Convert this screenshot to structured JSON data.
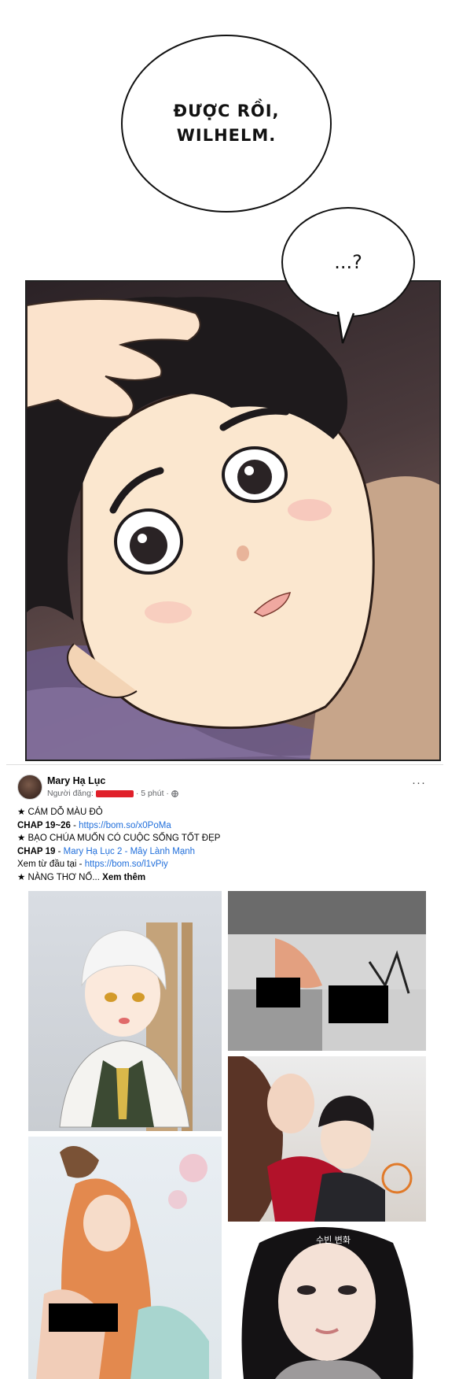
{
  "comic": {
    "bubble1_text": "ĐƯỢC RỒI,\nWILHELM.",
    "bubble2_text": "...?"
  },
  "post": {
    "author": "Mary Hạ Lục",
    "meta_prefix": "Người đăng:",
    "meta_time": "· 5 phút ·",
    "more_icon": "···",
    "lines": [
      {
        "star": "★ ",
        "text": "CÁM DỖ MÀU ĐỎ",
        "link": ""
      },
      {
        "bold": "CHAP 19~26",
        "sep": " - ",
        "link": "https://bom.so/x0PoMa"
      },
      {
        "star": "★ ",
        "text": "BẠO CHÚA MUỐN CÓ CUỘC SỐNG TỐT ĐẸP",
        "link": ""
      },
      {
        "bold": "CHAP 19",
        "sep": " - ",
        "link": "Mary Hạ Lục 2 - Mây Lành Mạnh"
      },
      {
        "plain": "Xem từ đầu tại - ",
        "link": "https://bom.so/l1vPiy"
      },
      {
        "star": "★ ",
        "text": "NÀNG THƠ NỔ...",
        "see_more": " Xem thêm"
      }
    ],
    "tile_caption": "수빈 변화"
  }
}
